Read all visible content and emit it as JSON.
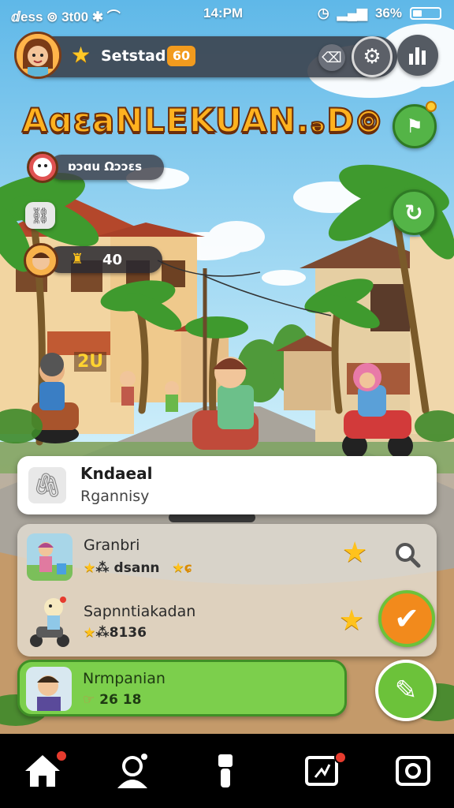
{
  "status_bar": {
    "left": "ⅆess ⊚ 3t00 ✱ ⌒",
    "time": "14:PM",
    "battery": "36%"
  },
  "header": {
    "player_name": "Setstad",
    "level": "60"
  },
  "game": {
    "title": "AɑɛaNLEKUAN.ₔD⊚",
    "subtitle": "ɒɔɑu Ωɔɔɛs",
    "coins": "40",
    "sign": "2U"
  },
  "search_card": {
    "title": "Kndaeal",
    "subtitle": "Rgannisy"
  },
  "list": {
    "items": [
      {
        "name": "Granbri",
        "meta": "⁂ dsann",
        "meta2": "ɕ"
      },
      {
        "name": "Sapnntiakadan",
        "meta": "⁂8136"
      }
    ],
    "active": {
      "name": "Nrmpanian",
      "meta": "26 18"
    }
  },
  "colors": {
    "accent_green": "#7ccf4c",
    "title_orange": "#ffb21f",
    "button_orange": "#f28a1c",
    "level_badge": "#f29b1e"
  },
  "icons": [
    "star-icon",
    "eraser-icon",
    "gear-icon",
    "bars-icon",
    "flag-icon",
    "refresh-icon",
    "search-icon",
    "check-icon",
    "pencil-icon",
    "home-icon",
    "character-icon",
    "flashlight-icon",
    "broken-screen-icon",
    "camera-icon"
  ]
}
